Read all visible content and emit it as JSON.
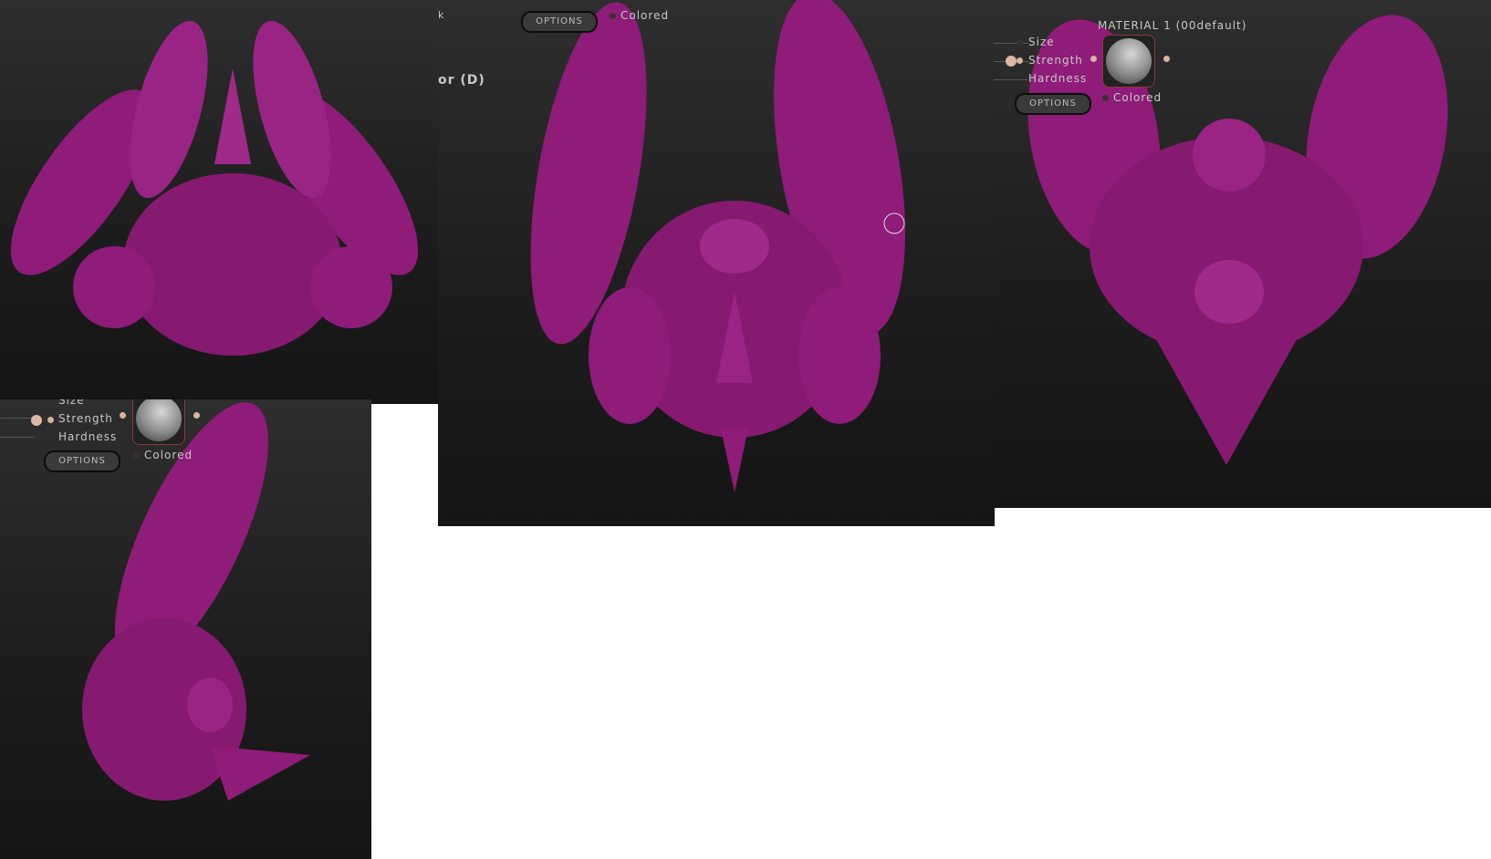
{
  "brush_panel": {
    "size_label": "Size",
    "strength_label": "Strength",
    "hardness_label": "Hardness",
    "options_label": "OPTIONS",
    "colored_label": "Colored",
    "material_label": "MATERIAL 1 (00default)"
  },
  "center_panel": {
    "partial_label_top": "k",
    "partial_label_mid": "or (D)"
  },
  "colors": {
    "model": "#8e1c78",
    "background": "#1e1e1e"
  }
}
